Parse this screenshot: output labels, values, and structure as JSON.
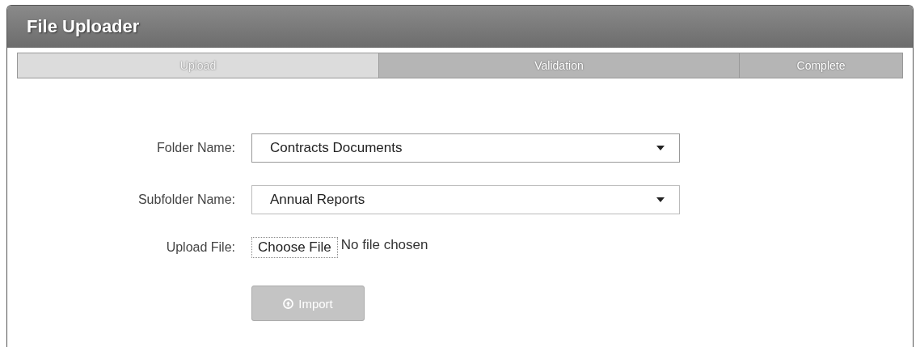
{
  "window": {
    "title": "File Uploader"
  },
  "steps": [
    {
      "label": "Upload",
      "selected": true
    },
    {
      "label": "Validation",
      "selected": false
    },
    {
      "label": "Complete",
      "selected": false
    }
  ],
  "form": {
    "fields": [
      {
        "kind": "select",
        "label": "Folder Name:",
        "value": "Contracts Documents"
      },
      {
        "kind": "select",
        "label": "Subfolder Name:",
        "value": "Annual Reports"
      },
      {
        "kind": "file",
        "label": "Upload File:",
        "button": "Choose File",
        "status": "No file chosen"
      }
    ],
    "import_button": {
      "label": "Import",
      "disabled": true
    }
  }
}
